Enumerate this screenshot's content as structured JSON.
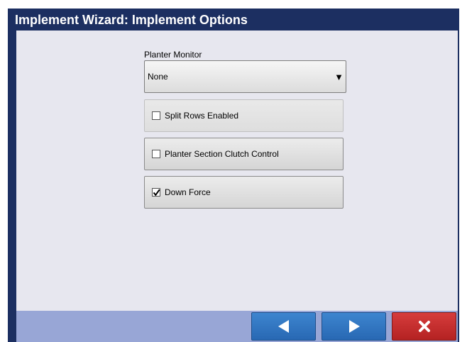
{
  "window": {
    "title": "Implement Wizard: Implement Options"
  },
  "planter_monitor": {
    "label": "Planter Monitor",
    "selected": "None"
  },
  "options": [
    {
      "label": "Split Rows Enabled",
      "checked": false,
      "enabled": false
    },
    {
      "label": "Planter Section Clutch Control",
      "checked": false,
      "enabled": true
    },
    {
      "label": "Down Force",
      "checked": true,
      "enabled": true
    }
  ],
  "footer": {
    "buttons": [
      {
        "icon": "back-arrow-icon",
        "color": "#2f74c0"
      },
      {
        "icon": "forward-arrow-icon",
        "color": "#2f74c0"
      },
      {
        "icon": "close-icon",
        "color": "#c42b2b"
      }
    ]
  },
  "colors": {
    "title_bar": "#1c2f61",
    "content_bg": "#e7e7ef",
    "footer_bg": "#98a6d6"
  }
}
